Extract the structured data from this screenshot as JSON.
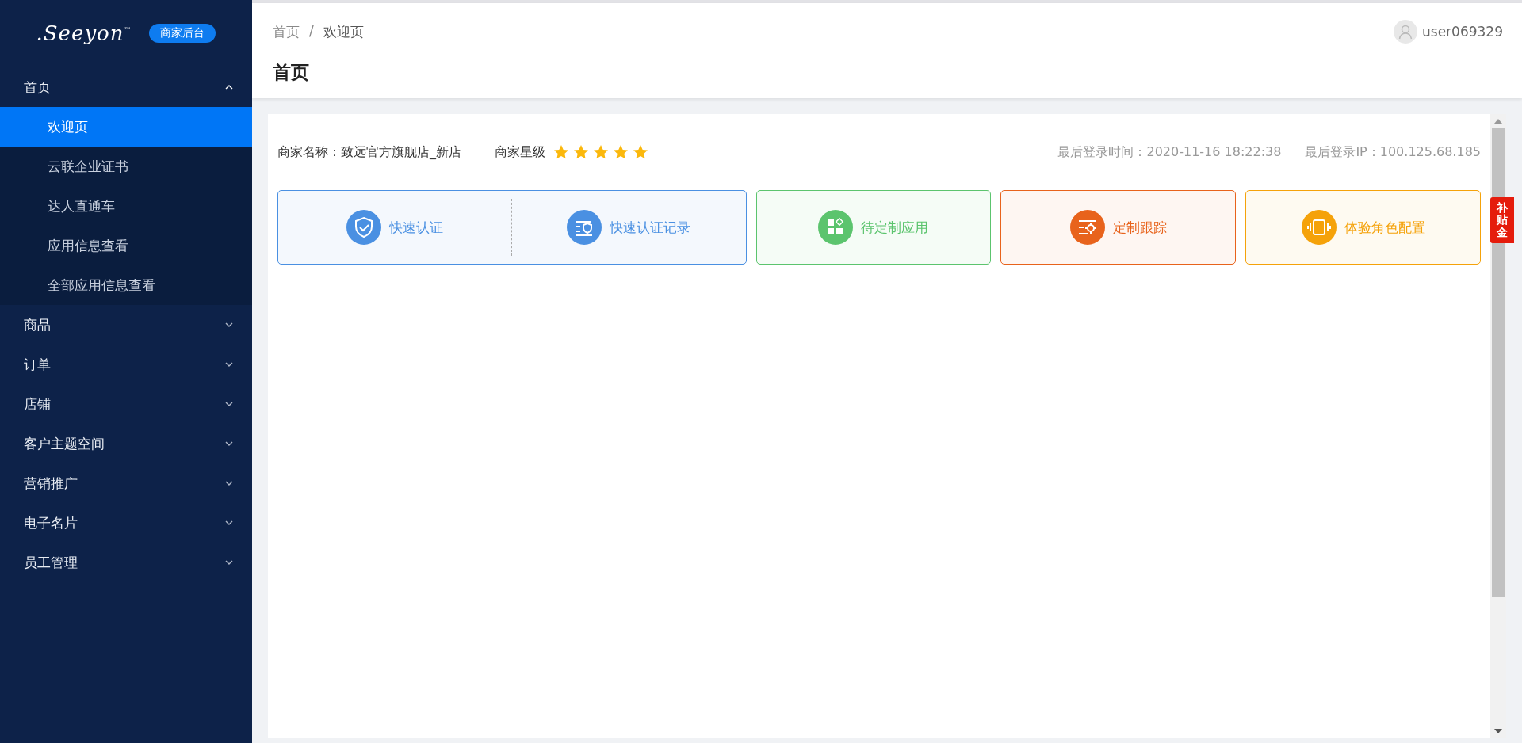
{
  "logo": {
    "text": ".Seeyon",
    "mark": "™",
    "badge": "商家后台"
  },
  "menu": [
    {
      "label": "首页",
      "expanded": true,
      "children": [
        {
          "label": "欢迎页",
          "selected": true
        },
        {
          "label": "云联企业证书",
          "selected": false
        },
        {
          "label": "达人直通车",
          "selected": false
        },
        {
          "label": "应用信息查看",
          "selected": false
        },
        {
          "label": "全部应用信息查看",
          "selected": false
        }
      ]
    },
    {
      "label": "商品",
      "expanded": false
    },
    {
      "label": "订单",
      "expanded": false
    },
    {
      "label": "店铺",
      "expanded": false
    },
    {
      "label": "客户主题空间",
      "expanded": false
    },
    {
      "label": "营销推广",
      "expanded": false
    },
    {
      "label": "电子名片",
      "expanded": false
    },
    {
      "label": "员工管理",
      "expanded": false
    }
  ],
  "breadcrumb": [
    "首页",
    "欢迎页"
  ],
  "breadcrumb_separator": "/",
  "user": {
    "name": "user069329"
  },
  "page_title": "首页",
  "merchant": {
    "name_label": "商家名称：",
    "name": "致远官方旗舰店_新店",
    "rating_label": "商家星级",
    "stars": 5,
    "last_login_time": "最后登录时间：2020-11-16 18:22:38",
    "last_login_ip": "最后登录IP：100.125.68.185"
  },
  "cards": [
    {
      "color": "#4a90e2",
      "actions": [
        {
          "label": "快速认证",
          "kind": "shield"
        },
        {
          "label": "快速认证记录",
          "kind": "record"
        }
      ]
    },
    {
      "color": "#5cc46e",
      "actions": [
        {
          "label": "待定制应用",
          "kind": "blocks"
        }
      ]
    },
    {
      "color": "#e8631c",
      "actions": [
        {
          "label": "定制跟踪",
          "kind": "track"
        }
      ]
    },
    {
      "color": "#f5a20a",
      "actions": [
        {
          "label": "体验角色配置",
          "kind": "frame"
        }
      ]
    }
  ],
  "side_widget": {
    "text": "补贴金"
  }
}
